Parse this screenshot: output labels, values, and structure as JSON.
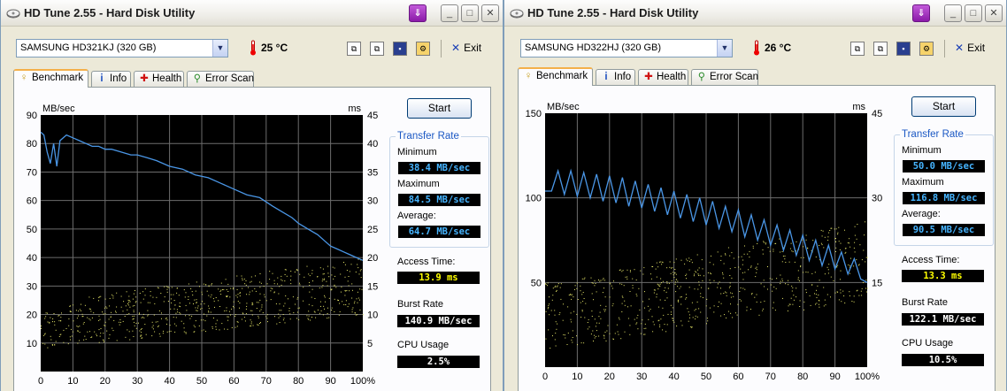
{
  "windows": [
    {
      "title": "HD Tune 2.55 - Hard Disk Utility",
      "drive": "SAMSUNG HD321KJ (320 GB)",
      "temperature": "25 °C",
      "exit_label": "Exit",
      "tabs": [
        "Benchmark",
        "Info",
        "Health",
        "Error Scan"
      ],
      "start_label": "Start",
      "transfer_rate_title": "Transfer Rate",
      "minimum_label": "Minimum",
      "minimum": "38.4 MB/sec",
      "maximum_label": "Maximum",
      "maximum": "84.5 MB/sec",
      "average_label": "Average:",
      "average": "64.7 MB/sec",
      "access_time_label": "Access Time:",
      "access_time": "13.9 ms",
      "burst_rate_label": "Burst Rate",
      "burst_rate": "140.9 MB/sec",
      "cpu_usage_label": "CPU Usage",
      "cpu_usage": "2.5%"
    },
    {
      "title": "HD Tune 2.55 - Hard Disk Utility",
      "drive": "SAMSUNG HD322HJ (320 GB)",
      "temperature": "26 °C",
      "exit_label": "Exit",
      "tabs": [
        "Benchmark",
        "Info",
        "Health",
        "Error Scan"
      ],
      "start_label": "Start",
      "transfer_rate_title": "Transfer Rate",
      "minimum_label": "Minimum",
      "minimum": "50.0 MB/sec",
      "maximum_label": "Maximum",
      "maximum": "116.8 MB/sec",
      "average_label": "Average:",
      "average": "90.5 MB/sec",
      "access_time_label": "Access Time:",
      "access_time": "13.3 ms",
      "burst_rate_label": "Burst Rate",
      "burst_rate": "122.1 MB/sec",
      "cpu_usage_label": "CPU Usage",
      "cpu_usage": "10.5%"
    }
  ],
  "chart_data": [
    {
      "type": "line",
      "ylabel": "MB/sec",
      "y2label": "ms",
      "x_ticks": [
        "0",
        "10",
        "20",
        "30",
        "40",
        "50",
        "60",
        "70",
        "80",
        "90",
        "100%"
      ],
      "ylim": [
        0,
        90
      ],
      "y_ticks": [
        "10",
        "20",
        "30",
        "40",
        "50",
        "60",
        "70",
        "80",
        "90"
      ],
      "y2lim": [
        0,
        45
      ],
      "y2_ticks": [
        "5",
        "10",
        "15",
        "20",
        "25",
        "30",
        "35",
        "40",
        "45"
      ],
      "grid": true,
      "transfer_rate_series": {
        "x": [
          0,
          1,
          2,
          3,
          4,
          5,
          6,
          8,
          10,
          12,
          14,
          16,
          18,
          20,
          22,
          25,
          28,
          30,
          33,
          36,
          40,
          44,
          48,
          52,
          56,
          60,
          64,
          68,
          72,
          75,
          78,
          80,
          83,
          86,
          88,
          90,
          92,
          94,
          96,
          98,
          100
        ],
        "y": [
          84,
          83,
          77,
          73,
          80,
          72,
          81,
          83,
          82,
          81,
          80,
          79,
          79,
          78,
          78,
          77,
          76,
          76,
          75,
          74,
          72,
          71,
          69,
          68,
          66,
          64,
          62,
          61,
          58,
          56,
          54,
          52,
          50,
          48,
          46,
          44,
          43,
          42,
          41,
          40,
          39
        ]
      },
      "access_time_scatter": {
        "x_range": [
          0,
          100
        ],
        "y_ms_min_at_start": 4,
        "y_ms_max_at_start": 12,
        "y_ms_min_at_end": 10,
        "y_ms_max_at_end": 20
      }
    },
    {
      "type": "line",
      "ylabel": "MB/sec",
      "y2label": "ms",
      "x_ticks": [
        "0",
        "10",
        "20",
        "30",
        "40",
        "50",
        "60",
        "70",
        "80",
        "90",
        "100%"
      ],
      "ylim": [
        0,
        150
      ],
      "y_ticks": [
        "50",
        "100",
        "150"
      ],
      "y2lim": [
        0,
        45
      ],
      "y2_ticks": [
        "15",
        "30",
        "45"
      ],
      "grid": true,
      "transfer_rate_series": {
        "x": [
          0,
          2,
          4,
          6,
          8,
          10,
          12,
          14,
          16,
          18,
          20,
          22,
          24,
          26,
          28,
          30,
          32,
          34,
          36,
          38,
          40,
          42,
          44,
          46,
          48,
          50,
          52,
          54,
          56,
          58,
          60,
          62,
          64,
          66,
          68,
          70,
          72,
          74,
          76,
          78,
          80,
          82,
          84,
          86,
          88,
          90,
          92,
          94,
          96,
          98,
          100
        ],
        "y": [
          104,
          104,
          116,
          102,
          116,
          101,
          115,
          100,
          114,
          98,
          113,
          97,
          112,
          95,
          110,
          94,
          108,
          92,
          106,
          90,
          104,
          88,
          102,
          86,
          100,
          84,
          98,
          82,
          95,
          80,
          93,
          77,
          90,
          75,
          87,
          72,
          84,
          69,
          81,
          66,
          78,
          63,
          75,
          60,
          72,
          58,
          68,
          55,
          64,
          52,
          50
        ]
      },
      "access_time_scatter": {
        "x_range": [
          0,
          100
        ],
        "y_ms_min_at_start": 3,
        "y_ms_max_at_start": 15,
        "y_ms_min_at_end": 12,
        "y_ms_max_at_end": 26
      }
    }
  ]
}
